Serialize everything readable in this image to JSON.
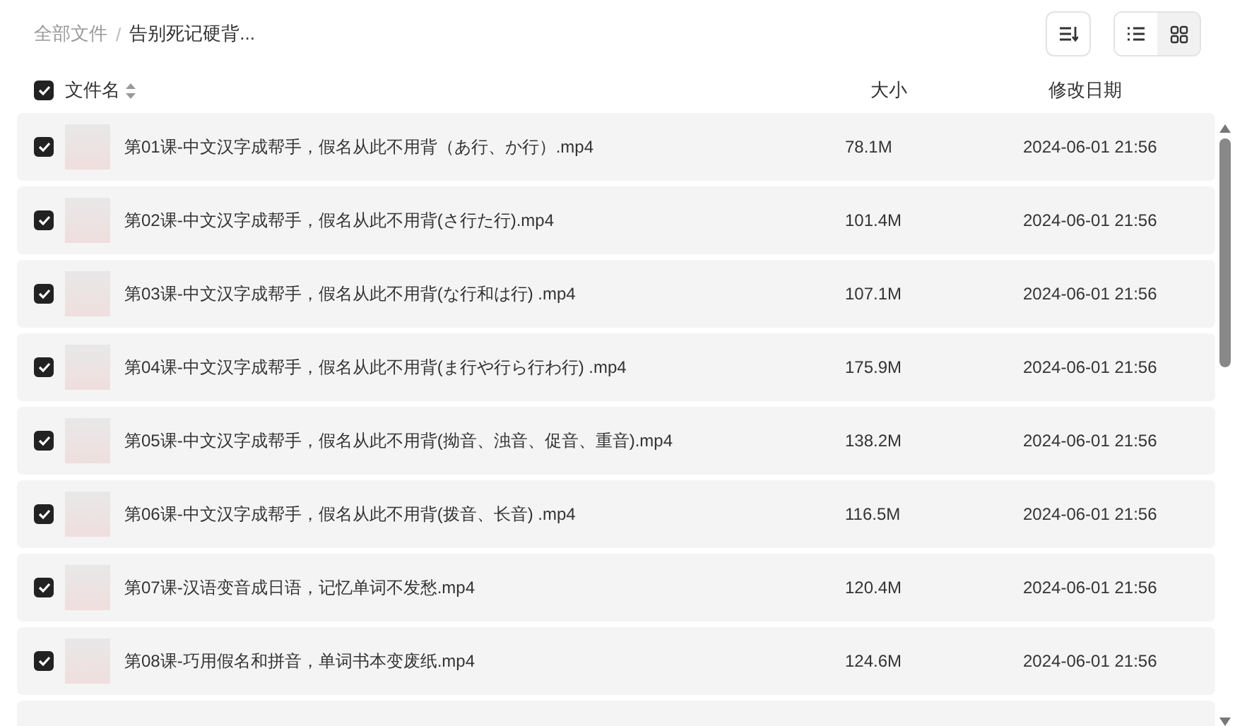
{
  "breadcrumb_separator": "/",
  "breadcrumb": [
    {
      "label": "全部文件",
      "current": false
    },
    {
      "label": "告别死记硬背...",
      "current": true
    }
  ],
  "toolbar": {
    "view_modes": [
      {
        "kind": "list",
        "selected": false
      },
      {
        "kind": "grid",
        "selected": true
      }
    ]
  },
  "columns": {
    "select_all_checked": true,
    "name": "文件名",
    "size": "大小",
    "modified": "修改日期"
  },
  "rows": [
    {
      "checked": true,
      "name": "第01课-中文汉字成帮手，假名从此不用背（あ行、か行）.mp4",
      "size": "78.1M",
      "modified": "2024-06-01 21:56"
    },
    {
      "checked": true,
      "name": "第02课-中文汉字成帮手，假名从此不用背(さ行た行).mp4",
      "size": "101.4M",
      "modified": "2024-06-01 21:56"
    },
    {
      "checked": true,
      "name": "第03课-中文汉字成帮手，假名从此不用背(な行和は行) .mp4",
      "size": "107.1M",
      "modified": "2024-06-01 21:56"
    },
    {
      "checked": true,
      "name": "第04课-中文汉字成帮手，假名从此不用背(ま行や行ら行わ行) .mp4",
      "size": "175.9M",
      "modified": "2024-06-01 21:56"
    },
    {
      "checked": true,
      "name": "第05课-中文汉字成帮手，假名从此不用背(拗音、浊音、促音、重音).mp4",
      "size": "138.2M",
      "modified": "2024-06-01 21:56"
    },
    {
      "checked": true,
      "name": "第06课-中文汉字成帮手，假名从此不用背(拨音、长音) .mp4",
      "size": "116.5M",
      "modified": "2024-06-01 21:56"
    },
    {
      "checked": true,
      "name": "第07课-汉语变音成日语，记忆单词不发愁.mp4",
      "size": "120.4M",
      "modified": "2024-06-01 21:56"
    },
    {
      "checked": true,
      "name": "第08课-巧用假名和拼音，单词书本变废纸.mp4",
      "size": "124.6M",
      "modified": "2024-06-01 21:56"
    }
  ]
}
